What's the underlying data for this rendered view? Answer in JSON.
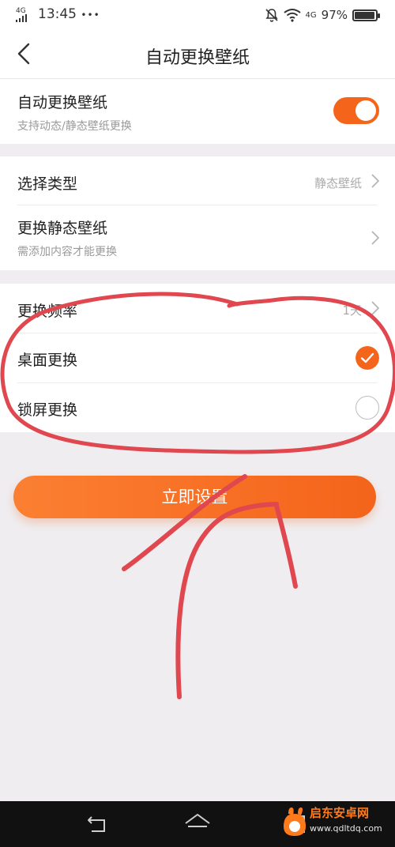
{
  "status_bar": {
    "network_tag": "4G",
    "time": "13:45",
    "dots": "•••",
    "right_network_tag": "4G",
    "battery": "97%",
    "battery_level": 0.97
  },
  "header": {
    "title": "自动更换壁纸"
  },
  "section1": {
    "auto_label": "自动更换壁纸",
    "auto_sub": "支持动态/静态壁纸更换",
    "auto_on": true
  },
  "section2": {
    "type_label": "选择类型",
    "type_value": "静态壁纸",
    "static_label": "更换静态壁纸",
    "static_sub": "需添加内容才能更换"
  },
  "section3": {
    "freq_label": "更换频率",
    "freq_value": "1天",
    "desktop_label": "桌面更换",
    "desktop_checked": true,
    "lock_label": "锁屏更换",
    "lock_checked": false
  },
  "action": {
    "button_label": "立即设置"
  },
  "watermark": {
    "name": "启东安卓网",
    "url": "www.qdltdq.com"
  },
  "colors": {
    "accent": "#f4641b",
    "accent_light": "#fb7f32",
    "annotation": "#e0474f"
  },
  "icons": {
    "back": "chevron-left-icon",
    "chevron": "chevron-right-icon",
    "check": "check-icon",
    "nav_back": "nav-back-icon",
    "nav_home": "nav-home-icon",
    "nav_recent": "nav-recent-icon"
  }
}
